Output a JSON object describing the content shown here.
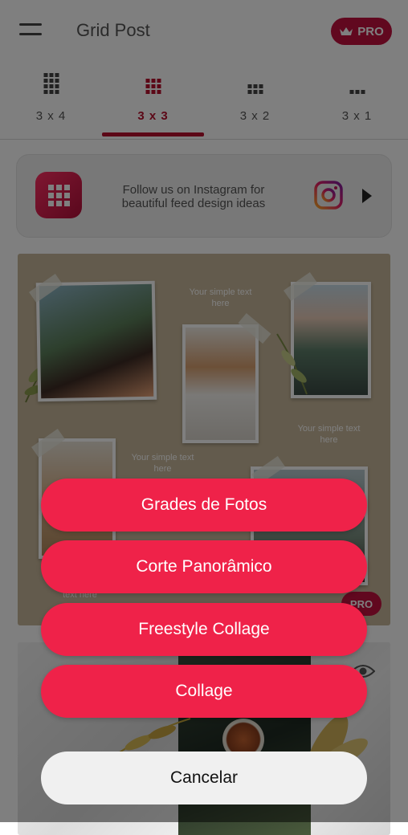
{
  "header": {
    "menu_icon": "hamburger-menu-icon",
    "title": "Grid Post",
    "pro_label": "PRO",
    "pro_icon": "crown-icon"
  },
  "tabs": [
    {
      "label": "3 x 4",
      "active": false
    },
    {
      "label": "3 x 3",
      "active": true
    },
    {
      "label": "3 x 2",
      "active": false
    },
    {
      "label": "3 x 1",
      "active": false
    }
  ],
  "banner": {
    "text": "Follow us on Instagram for beautiful feed design ideas",
    "logo_icon": "grid-app-logo-icon",
    "instagram_icon": "instagram-icon",
    "arrow_icon": "play-arrow-icon"
  },
  "template1": {
    "placeholder_texts": [
      "Your simple text here",
      "Your simple text here",
      "Your simple text here",
      "text here"
    ],
    "pro_label": "PRO"
  },
  "template2": {
    "eye_icon": "eye-icon"
  },
  "action_sheet": {
    "options": [
      {
        "label": "Grades de Fotos"
      },
      {
        "label": "Corte Panorâmico"
      },
      {
        "label": "Freestyle Collage"
      },
      {
        "label": "Collage"
      }
    ],
    "cancel_label": "Cancelar"
  },
  "colors": {
    "accent": "#b8102e",
    "button": "#ef2249",
    "cancel_background": "#f0f0f0"
  }
}
